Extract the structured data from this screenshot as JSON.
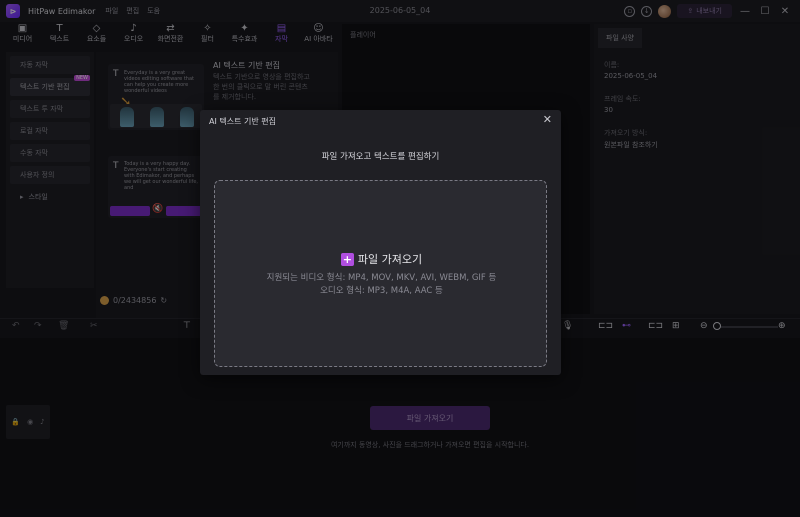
{
  "app": {
    "name": "HitPaw Edimakor",
    "menu": [
      "파일",
      "편집",
      "도움"
    ],
    "project_date": "2025-06-05_04",
    "upgrade_label": "내보내기",
    "window_controls": [
      "minimize-icon",
      "maximize-icon",
      "close-icon"
    ]
  },
  "toolbar": [
    {
      "icon": "media-icon",
      "glyph": "▣",
      "label": "미디어"
    },
    {
      "icon": "text-icon",
      "glyph": "T",
      "label": "텍스트"
    },
    {
      "icon": "elements-icon",
      "glyph": "◇",
      "label": "요소들"
    },
    {
      "icon": "audio-icon",
      "glyph": "♪",
      "label": "오디오"
    },
    {
      "icon": "transition-icon",
      "glyph": "⇄",
      "label": "화면전환"
    },
    {
      "icon": "filter-icon",
      "glyph": "✧",
      "label": "필터"
    },
    {
      "icon": "effects-icon",
      "glyph": "✦",
      "label": "특수효과"
    },
    {
      "icon": "subtitle-icon",
      "glyph": "▤",
      "label": "자막",
      "active": true
    },
    {
      "icon": "ai-avatar-icon",
      "glyph": "☺",
      "label": "AI 아바타"
    }
  ],
  "sidebar": {
    "items": [
      {
        "label": "자동 자막"
      },
      {
        "label": "텍스트 기반 편집",
        "badge": "NEW",
        "selected": true
      },
      {
        "label": "텍스트 투 자막"
      },
      {
        "label": "로컬 자막"
      },
      {
        "label": "수동 자막"
      },
      {
        "label": "사용자 정의"
      }
    ],
    "style_label": "스타일"
  },
  "cards": {
    "text_edit": {
      "title": "AI 텍스트 기반 편집",
      "desc": [
        "텍스트 기반으로 영상을 편집하고",
        "한 번의 클릭으로 말 버린 콘텐츠",
        "를 제거합니다."
      ]
    },
    "sample_text_1": "Everyday is a very great videos editing software that can help you create more wonderful videos",
    "sample_text_2": "Today is a very happy day. Everyone's start creating with Edimakor, and perhaps we will get our wonderful life, and"
  },
  "credits": {
    "value": "0/2434856"
  },
  "preview": {
    "title": "플레이어"
  },
  "right_panel": {
    "tab": "파일 사양",
    "fields": [
      {
        "label": "이름:",
        "value": "2025-06-05_04"
      },
      {
        "label": "프레임 속도:",
        "value": "30"
      },
      {
        "label": "가져오기 방식:",
        "value": "원본파일 참조하기"
      }
    ]
  },
  "timeline": {
    "import_button": "파일 가져오기",
    "hint": "여기까지 동영상, 사진을 드래그하거나 가져오면 편집을 시작합니다."
  },
  "modal": {
    "title": "AI 텍스트 기반 편집",
    "subtitle": "파일 가져오고 텍스트를 편집하기",
    "dropzone_title": "파일 가져오기",
    "video_formats": "지원되는 비디오 형식: MP4, MOV, MKV, AVI, WEBM, GIF 등",
    "audio_formats": "오디오 형식: MP3, M4A, AAC 등"
  }
}
